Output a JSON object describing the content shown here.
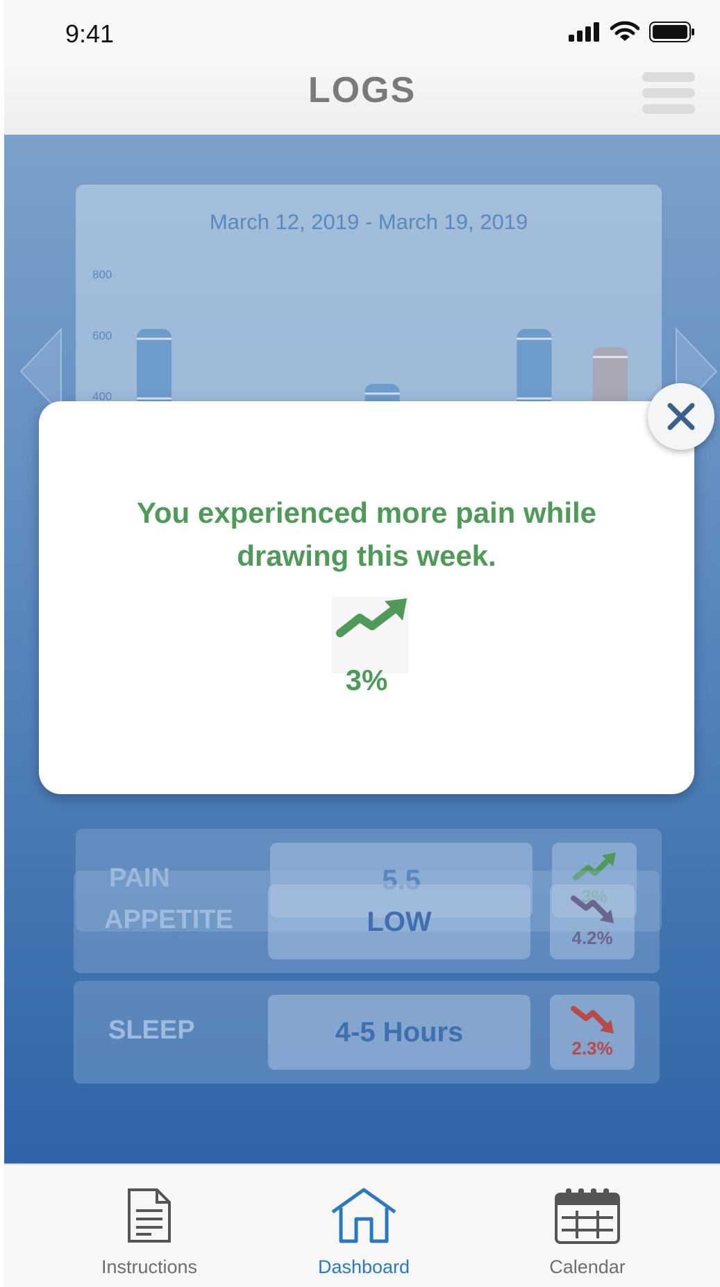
{
  "status_bar": {
    "time": "9:41"
  },
  "header": {
    "title": "LOGS"
  },
  "chart": {
    "date_range": "March 12, 2019 - March 19, 2019"
  },
  "chart_data": {
    "type": "bar",
    "title": "March 12, 2019 - March 19, 2019",
    "ylim": [
      0,
      800
    ],
    "yticks": [
      800,
      600,
      400
    ],
    "values": [
      620,
      375,
      null,
      440,
      null,
      620,
      560
    ],
    "bar_colors": [
      "#6d9ccb",
      "#6d9ccb",
      "#6d9ccb",
      "#6d9ccb",
      "#6d9ccb",
      "#6d9ccb",
      "#a9a6b6"
    ]
  },
  "metrics": [
    {
      "label": "PAIN",
      "value": "5.5",
      "trend": "up",
      "pct": "3%",
      "color": "#4f9a58"
    },
    {
      "label": "APPETITE",
      "value": "LOW",
      "trend": "down",
      "pct": "4.2%",
      "color": "#6a6690"
    },
    {
      "label": "SLEEP",
      "value": "4-5 Hours",
      "trend": "down",
      "pct": "2.3%",
      "color": "#b94a48"
    }
  ],
  "modal": {
    "message": "You experienced more pain while drawing this week.",
    "trend_icon": "trend-up-icon",
    "pct": "3%",
    "accent": "#4f9a58"
  },
  "tab_bar": {
    "tabs": [
      {
        "label": "Instructions",
        "icon": "document-icon",
        "active": false
      },
      {
        "label": "Dashboard",
        "icon": "home-icon",
        "active": true
      },
      {
        "label": "Calendar",
        "icon": "calendar-icon",
        "active": false
      }
    ],
    "active_color": "#2a78c2",
    "inactive_color": "#6e6e6e"
  }
}
